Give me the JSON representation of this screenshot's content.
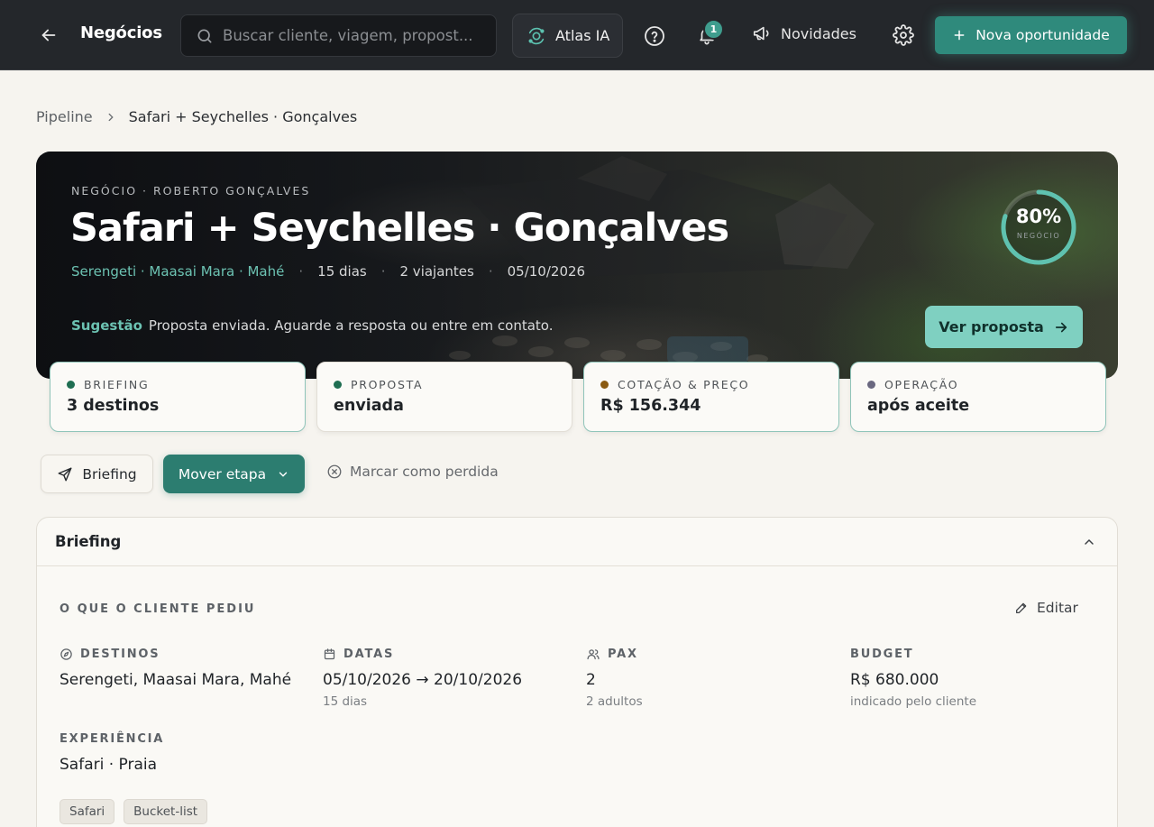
{
  "header": {
    "title": "Negócios",
    "search_placeholder": "Buscar cliente, viagem, propost...",
    "atlas_label": "Atlas IA",
    "notifications_count": "1",
    "news_label": "Novidades",
    "new_opportunity_label": "Nova oportunidade"
  },
  "breadcrumb": {
    "parent": "Pipeline",
    "current": "Safari + Seychelles · Gonçalves"
  },
  "hero": {
    "kicker": "NEGÓCIO · ROBERTO GONÇALVES",
    "title": "Safari + Seychelles · Gonçalves",
    "destinations": "Serengeti · Maasai Mara · Mahé",
    "duration": "15 dias",
    "travelers": "2 viajantes",
    "date": "05/10/2026",
    "separator": "·",
    "suggestion_label": "Sugestão",
    "suggestion_text": "Proposta enviada. Aguarde a resposta ou entre em contato.",
    "progress_value": "80%",
    "progress_fraction": 0.8,
    "progress_label": "NEGÓCIO",
    "view_proposal_label": "Ver proposta"
  },
  "stages": [
    {
      "label": "BRIEFING",
      "value": "3 destinos",
      "dot_color": "#1f6e52"
    },
    {
      "label": "PROPOSTA",
      "value": "enviada",
      "dot_color": "#1f6e52"
    },
    {
      "label": "COTAÇÃO & PREÇO",
      "value": "R$ 156.344",
      "dot_color": "#8a5a12"
    },
    {
      "label": "OPERAÇÃO",
      "value": "após aceite",
      "dot_color": "#6a6880"
    }
  ],
  "actions": {
    "briefing_label": "Briefing",
    "move_stage_label": "Mover etapa",
    "mark_lost_label": "Marcar como perdida"
  },
  "briefing": {
    "title": "Briefing",
    "section_label": "O QUE O CLIENTE PEDIU",
    "edit_label": "Editar",
    "destinos_label": "DESTINOS",
    "destinos_value": "Serengeti, Maasai Mara, Mahé",
    "datas_label": "DATAS",
    "datas_value": "05/10/2026 → 20/10/2026",
    "datas_sub": "15 dias",
    "pax_label": "PAX",
    "pax_value": "2",
    "pax_sub": "2 adultos",
    "budget_label": "BUDGET",
    "budget_value": "R$ 680.000",
    "budget_sub": "indicado pelo cliente",
    "experiencia_label": "EXPERIÊNCIA",
    "experiencia_value": "Safari · Praia",
    "tags": [
      "Safari",
      "Bucket-list"
    ]
  },
  "colors": {
    "accent": "#2f8a7c",
    "accent_light": "#7fd0c1",
    "topbar": "#24272b"
  },
  "icons": [
    "back-arrow-icon",
    "search-icon",
    "atlas-orbit-icon",
    "help-icon",
    "bell-icon",
    "megaphone-icon",
    "gear-icon",
    "plus-icon",
    "chevron-right-icon",
    "arrow-right-icon",
    "send-icon",
    "chevron-down-icon",
    "x-circle-icon",
    "chevron-up-icon",
    "pencil-icon",
    "compass-icon",
    "calendar-icon",
    "users-icon"
  ]
}
